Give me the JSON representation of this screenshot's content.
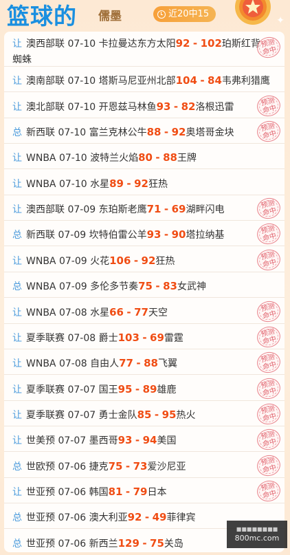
{
  "header": {
    "title": "篮球的",
    "author": "儒墨",
    "badge": "近20中15"
  },
  "stamp_text": [
    "预测",
    "命中"
  ],
  "rows": [
    {
      "tag": "让",
      "league": "澳西部联",
      "date": "07-10",
      "home": "卡拉曼达东方太阳",
      "home_score": "92",
      "sep": "-",
      "away_score": "102",
      "away": "珀斯红背蜘蛛",
      "hit": true
    },
    {
      "tag": "让",
      "league": "澳南部联",
      "date": "07-10",
      "home": "塔斯马尼亚州北部",
      "home_score": "104",
      "sep": "-",
      "away_score": "84",
      "away": "韦弗利猎鹰",
      "hit": false
    },
    {
      "tag": "让",
      "league": "澳北部联",
      "date": "07-10",
      "home": "开恩兹马林鱼",
      "home_score": "93",
      "sep": "-",
      "away_score": "82",
      "away": "洛根迅雷",
      "hit": true
    },
    {
      "tag": "总",
      "league": "新西联",
      "date": "07-10",
      "home": "富兰克林公牛",
      "home_score": "88",
      "sep": "-",
      "away_score": "92",
      "away": "奥塔哥金块",
      "hit": true
    },
    {
      "tag": "让",
      "league": "WNBA",
      "date": "07-10",
      "home": "波特兰火焰",
      "home_score": "80",
      "sep": "-",
      "away_score": "88",
      "away": "王牌",
      "hit": false
    },
    {
      "tag": "让",
      "league": "WNBA",
      "date": "07-10",
      "home": "水星",
      "home_score": "89",
      "sep": "-",
      "away_score": "92",
      "away": "狂热",
      "hit": false
    },
    {
      "tag": "让",
      "league": "澳西部联",
      "date": "07-09",
      "home": "东珀斯老鹰",
      "home_score": "71",
      "sep": "-",
      "away_score": "69",
      "away": "湖畔闪电",
      "hit": true
    },
    {
      "tag": "总",
      "league": "新西联",
      "date": "07-09",
      "home": "坎特伯雷公羊",
      "home_score": "93",
      "sep": "-",
      "away_score": "90",
      "away": "塔拉纳基",
      "hit": true
    },
    {
      "tag": "让",
      "league": "WNBA",
      "date": "07-09",
      "home": "火花",
      "home_score": "106",
      "sep": "-",
      "away_score": "92",
      "away": "狂热",
      "hit": true
    },
    {
      "tag": "总",
      "league": "WNBA",
      "date": "07-09",
      "home": "多伦多节奏",
      "home_score": "75",
      "sep": "-",
      "away_score": "83",
      "away": "女武神",
      "hit": false
    },
    {
      "tag": "让",
      "league": "WNBA",
      "date": "07-08",
      "home": "水星",
      "home_score": "66",
      "sep": "-",
      "away_score": "77",
      "away": "天空",
      "hit": true
    },
    {
      "tag": "让",
      "league": "夏季联赛",
      "date": "07-08",
      "home": "爵士",
      "home_score": "103",
      "sep": "-",
      "away_score": "69",
      "away": "雷霆",
      "hit": true
    },
    {
      "tag": "让",
      "league": "WNBA",
      "date": "07-08",
      "home": "自由人",
      "home_score": "77",
      "sep": "-",
      "away_score": "88",
      "away": "飞翼",
      "hit": true
    },
    {
      "tag": "让",
      "league": "夏季联赛",
      "date": "07-07",
      "home": "国王",
      "home_score": "95",
      "sep": "-",
      "away_score": "89",
      "away": "雄鹿",
      "hit": true
    },
    {
      "tag": "让",
      "league": "夏季联赛",
      "date": "07-07",
      "home": "勇士金队",
      "home_score": "85",
      "sep": "-",
      "away_score": "95",
      "away": "热火",
      "hit": true
    },
    {
      "tag": "让",
      "league": "世美预",
      "date": "07-07",
      "home": "墨西哥",
      "home_score": "93",
      "sep": "-",
      "away_score": "94",
      "away": "美国",
      "hit": true
    },
    {
      "tag": "总",
      "league": "世欧预",
      "date": "07-06",
      "home": "捷克",
      "home_score": "75",
      "sep": "-",
      "away_score": "73",
      "away": "爱沙尼亚",
      "hit": true
    },
    {
      "tag": "让",
      "league": "世亚预",
      "date": "07-06",
      "home": "韩国",
      "home_score": "81",
      "sep": "-",
      "away_score": "79",
      "away": "日本",
      "hit": true
    },
    {
      "tag": "总",
      "league": "世亚预",
      "date": "07-06",
      "home": "澳大利亚",
      "home_score": "92",
      "sep": "-",
      "away_score": "49",
      "away": "菲律宾",
      "hit": false
    },
    {
      "tag": "总",
      "league": "世亚预",
      "date": "07-06",
      "home": "新西兰",
      "home_score": "129",
      "sep": "-",
      "away_score": "75",
      "away": "关岛",
      "hit": false
    }
  ],
  "watermark": {
    "line1": "■■■■■■■■",
    "line2": "800mc.com"
  }
}
